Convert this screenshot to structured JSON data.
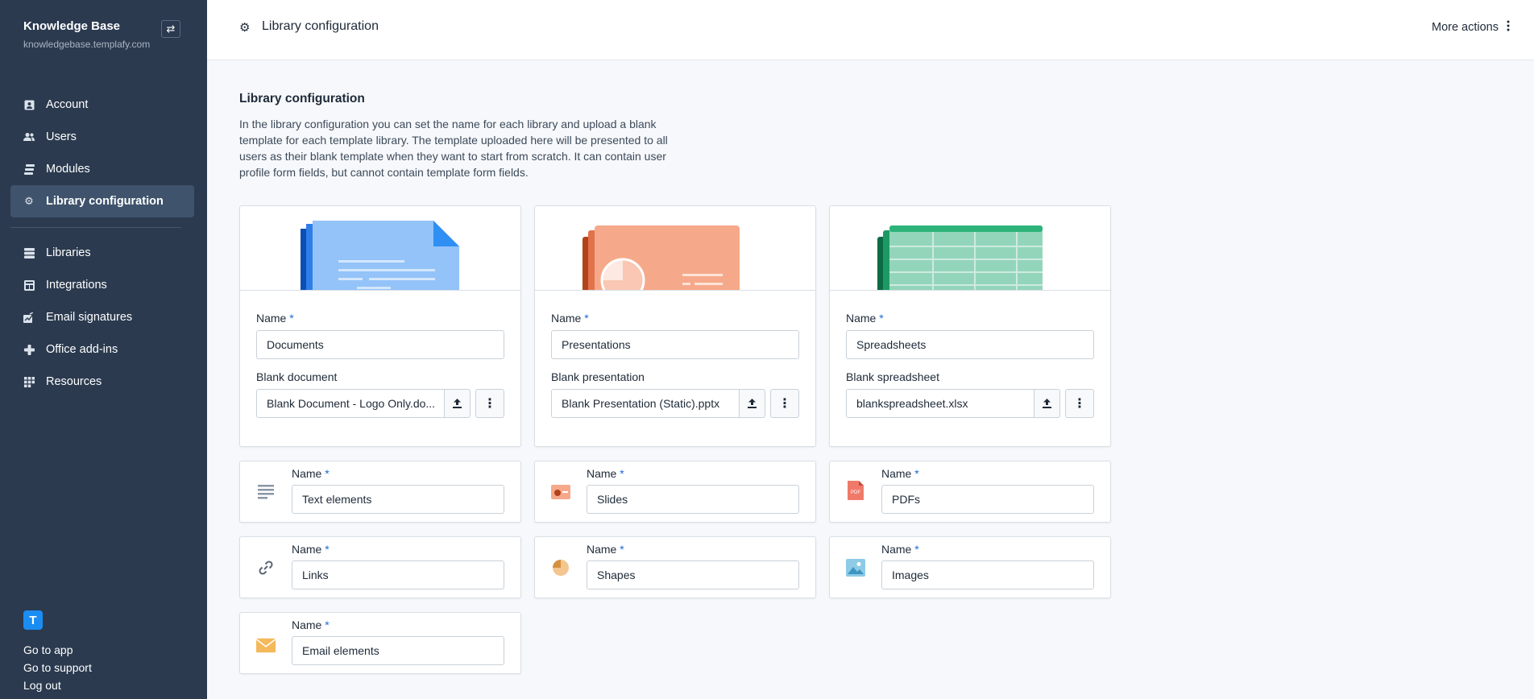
{
  "sidebar": {
    "org_name": "Knowledge Base",
    "org_url": "knowledgebase.templafy.com",
    "items": [
      {
        "label": "Account",
        "icon": "account-icon"
      },
      {
        "label": "Users",
        "icon": "users-icon"
      },
      {
        "label": "Modules",
        "icon": "modules-icon"
      },
      {
        "label": "Library configuration",
        "icon": "gear-icon",
        "active": true
      },
      {
        "label": "Libraries",
        "icon": "libraries-icon"
      },
      {
        "label": "Integrations",
        "icon": "integrations-icon"
      },
      {
        "label": "Email signatures",
        "icon": "email-signature-icon"
      },
      {
        "label": "Office add-ins",
        "icon": "office-addins-icon"
      },
      {
        "label": "Resources",
        "icon": "resources-icon"
      }
    ],
    "logo_letter": "T",
    "footer_links": [
      "Go to app",
      "Go to support",
      "Log out"
    ]
  },
  "topbar": {
    "title": "Library configuration",
    "more_actions": "More actions"
  },
  "main": {
    "section_title": "Library configuration",
    "description": "In the library configuration you can set the name for each library and upload a blank template for each template library. The template uploaded here will be presented to all users as their blank template when they want to start from scratch. It can contain user profile form fields, but cannot contain template form fields.",
    "name_label": "Name",
    "required_mark": "*",
    "template_cards": [
      {
        "name": "Documents",
        "blank_label": "Blank document",
        "file": "Blank Document - Logo Only.do..."
      },
      {
        "name": "Presentations",
        "blank_label": "Blank presentation",
        "file": "Blank Presentation (Static).pptx"
      },
      {
        "name": "Spreadsheets",
        "blank_label": "Blank spreadsheet",
        "file": "blankspreadsheet.xlsx"
      }
    ],
    "asset_cards": [
      {
        "name": "Text elements",
        "icon": "text-lines-icon"
      },
      {
        "name": "Slides",
        "icon": "slide-icon"
      },
      {
        "name": "PDFs",
        "icon": "pdf-icon"
      },
      {
        "name": "Links",
        "icon": "link-icon"
      },
      {
        "name": "Shapes",
        "icon": "pie-shape-icon"
      },
      {
        "name": "Images",
        "icon": "image-icon"
      },
      {
        "name": "Email elements",
        "icon": "envelope-icon"
      }
    ],
    "pdf_icon_text": "PDF"
  },
  "colors": {
    "sidebar_bg": "#2b3a4f",
    "active_item_bg": "#3f536c",
    "accent": "#1b8df2",
    "documents": "#93c3f8",
    "presentations": "#f6a98a",
    "spreadsheets": "#93d5bb"
  }
}
